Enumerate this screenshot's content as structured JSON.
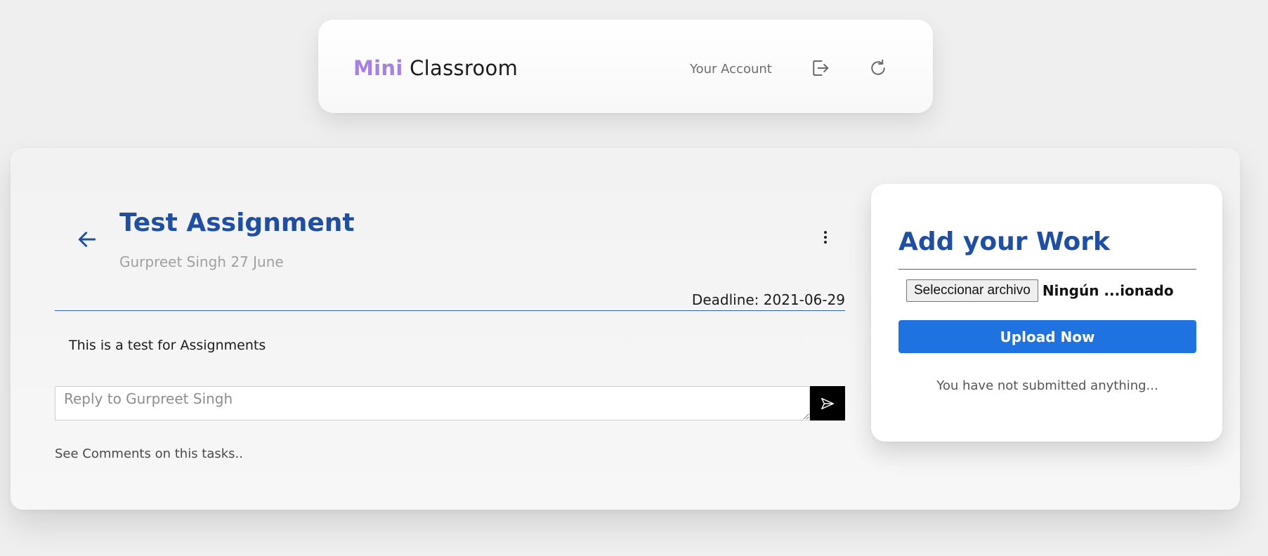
{
  "header": {
    "brand_mini": "Mini",
    "brand_classroom": "Classroom",
    "account_label": "Your Account",
    "icons": [
      "logout-icon",
      "refresh-icon"
    ]
  },
  "assignment": {
    "title": "Test Assignment",
    "meta": "Gurpreet Singh 27 June",
    "deadline": "Deadline: 2021-06-29",
    "description": "This is a test for Assignments",
    "reply_placeholder": "Reply to Gurpreet Singh",
    "comments_link": "See Comments on this tasks.."
  },
  "work": {
    "title": "Add your Work",
    "file_button_label": "Seleccionar archivo",
    "file_status": "Ningún ...ionado",
    "upload_label": "Upload Now",
    "submission_status": "You have not submitted anything..."
  },
  "colors": {
    "brand_mini": "#a881e0",
    "title_blue": "#1e4fa3",
    "upload_blue": "#1f73e0",
    "divider": "#2e5fa8"
  }
}
